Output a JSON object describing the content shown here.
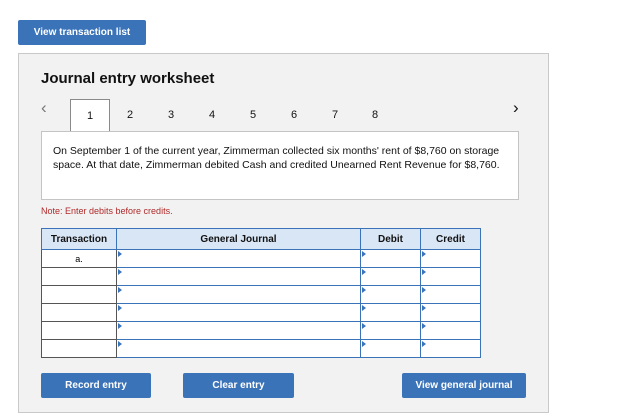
{
  "toolbar": {
    "view_transaction_list": "View transaction list"
  },
  "worksheet": {
    "title": "Journal entry worksheet",
    "tabs": [
      "1",
      "2",
      "3",
      "4",
      "5",
      "6",
      "7",
      "8"
    ],
    "active_tab": "1",
    "prev_icon": "chevron-left-icon",
    "next_icon": "chevron-right-icon",
    "description": "On September 1 of the current year, Zimmerman collected six months' rent of $8,760 on storage space. At that date, Zimmerman debited Cash and credited Unearned Rent Revenue for $8,760.",
    "note": "Note: Enter debits before credits.",
    "table": {
      "headers": [
        "Transaction",
        "General Journal",
        "Debit",
        "Credit"
      ],
      "rows": [
        {
          "transaction": "a.",
          "account": "",
          "debit": "",
          "credit": ""
        },
        {
          "transaction": "",
          "account": "",
          "debit": "",
          "credit": ""
        },
        {
          "transaction": "",
          "account": "",
          "debit": "",
          "credit": ""
        },
        {
          "transaction": "",
          "account": "",
          "debit": "",
          "credit": ""
        },
        {
          "transaction": "",
          "account": "",
          "debit": "",
          "credit": ""
        },
        {
          "transaction": "",
          "account": "",
          "debit": "",
          "credit": ""
        }
      ]
    },
    "buttons": {
      "record_entry": "Record entry",
      "clear_entry": "Clear entry",
      "view_general_journal": "View general journal"
    }
  },
  "colors": {
    "accent": "#3b73b9",
    "header_bg": "#d9e6f6",
    "note": "#b02a2a",
    "panel_bg": "#f2f2f2"
  }
}
